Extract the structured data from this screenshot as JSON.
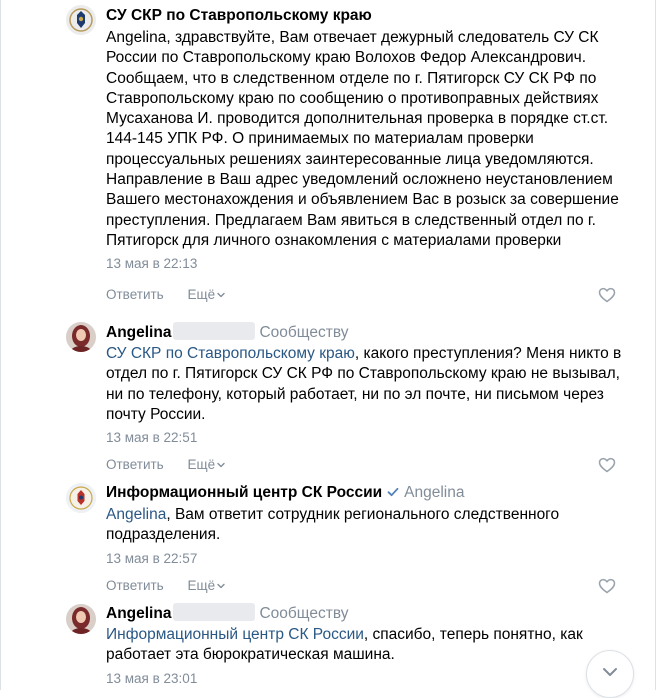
{
  "comments": [
    {
      "author": "СУ СКР по Ставропольскому краю",
      "text": "Angelina, здравствуйте, Вам отвечает дежурный следователь СУ СК России по Ставропольскому краю Волохов Федор Александрович. Сообщаем, что в следственном отделе по г. Пятигорск СУ СК РФ по Ставропольскому краю по сообщению о противоправных действиях Мусаханова И. проводится дополнительная проверка в порядке ст.ст. 144-145 УПК РФ. О принимаемых по материалам проверки процессуальных решениях заинтересованные лица уведомляются. Направление в Ваш адрес уведомлений осложнено неустановлением Вашего местонахождения и объявлением Вас в розыск за совершение преступления. Предлагаем Вам явиться в следственный отдел по г. Пятигорск для личного ознакомления с материалами проверки",
      "date": "13 мая в 22:13",
      "reply_label": "Ответить",
      "more_label": "Ещё"
    },
    {
      "author": "Angelina",
      "to": "Сообществу",
      "mention": "СУ СКР по Ставропольскому краю",
      "text": ", какого преступления? Меня никто в отдел по г. Пятигорск СУ СК РФ по Ставропольскому краю не вызывал, ни по телефону, который работает, ни по эл почте, ни письмом через почту России.",
      "date": "13 мая в 22:51",
      "reply_label": "Ответить",
      "more_label": "Ещё"
    },
    {
      "author": "Информационный центр СК России",
      "reply_to": "Angelina",
      "mention": "Angelina",
      "text": ", Вам ответит сотрудник регионального следственного подразделения.",
      "date": "13 мая в 22:57",
      "reply_label": "Ответить",
      "more_label": "Ещё"
    },
    {
      "author": "Angelina",
      "to": "Сообществу",
      "mention": "Информационный центр СК России",
      "text": ", спасибо, теперь понятно, как работает эта бюрократическая машина.",
      "date": "13 мая в 23:01"
    }
  ],
  "icons": {
    "like": "heart-outline-icon",
    "more_chevron": "chevron-down-icon",
    "verified": "verified-check-icon",
    "scroll_down": "chevron-down-icon"
  },
  "colors": {
    "link": "#2a5885",
    "meta": "#818c99",
    "verified": "#5181b8"
  }
}
